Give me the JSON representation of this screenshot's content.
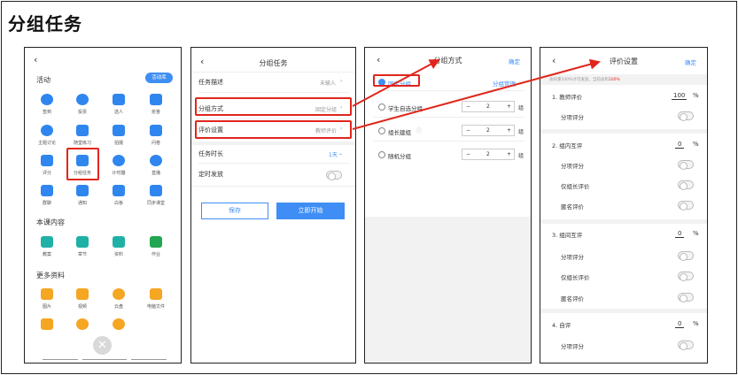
{
  "title": "分组任务",
  "phone1": {
    "sections": [
      "活动",
      "本课内容",
      "更多资料"
    ],
    "tag": "活动库",
    "activity_items": [
      "签到",
      "投票",
      "选人",
      "抢答",
      "主题讨论",
      "随堂练习",
      "拍摄",
      "问卷",
      "评分",
      "分组任务",
      "计时器",
      "直播",
      "群聊",
      "通知",
      "白板",
      "同步课堂"
    ],
    "lesson_items": [
      "教案",
      "章节",
      "资料",
      "作业"
    ],
    "more_items": [
      "图片",
      "视频",
      "云盘",
      "电脑文件"
    ]
  },
  "phone2": {
    "title": "分组任务",
    "rows": [
      {
        "label": "任务描述",
        "value": "未输入"
      },
      {
        "label": "分组方式",
        "value": "固定分组"
      },
      {
        "label": "评价设置",
        "value": "教师评价"
      },
      {
        "label": "任务时长",
        "value": "1天"
      },
      {
        "label": "定时发放",
        "value": ""
      }
    ],
    "save_button": "保存",
    "start_button": "立即开始"
  },
  "phone3": {
    "title": "分组方式",
    "confirm": "确定",
    "options": [
      {
        "label": "固定分组",
        "right": "分组管理"
      },
      {
        "label": "学生自选分组",
        "count": "2",
        "unit": "组"
      },
      {
        "label": "组长建组",
        "count": "2",
        "unit": "组"
      },
      {
        "label": "随机分组",
        "count": "2",
        "unit": "组"
      }
    ]
  },
  "phone4": {
    "title": "评价设置",
    "confirm": "确定",
    "note_prefix": "总权重100%才可发放，当前总和",
    "note_value": "100%",
    "groups": [
      {
        "name": "1. 教师评价",
        "pct": "100",
        "subs": [
          "分项评分"
        ]
      },
      {
        "name": "2. 组内互评",
        "pct": "0",
        "subs": [
          "分项评分",
          "仅组长评价",
          "匿名评价"
        ]
      },
      {
        "name": "3. 组间互评",
        "pct": "0",
        "subs": [
          "分项评分",
          "仅组长评价",
          "匿名评价"
        ]
      },
      {
        "name": "4. 自评",
        "pct": "0",
        "subs": [
          "分项评分"
        ]
      }
    ],
    "pct_sign": "%"
  },
  "colors": {
    "accent": "#3f8ef5",
    "highlight": "#e0261c",
    "red_note": "#e0261c"
  }
}
